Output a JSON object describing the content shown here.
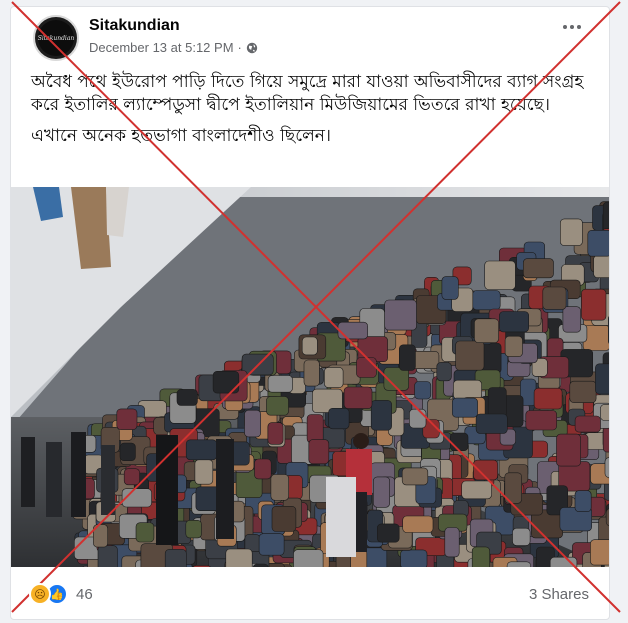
{
  "post": {
    "author": "Sitakundian",
    "timestamp": "December 13 at 5:12 PM",
    "separator": "·",
    "avatar_text": "Sitakundian",
    "privacy_icon": "globe-icon",
    "body_paragraph_1": "অবৈধ পথে ইউরোপ পাড়ি দিতে গিয়ে সমুদ্রে মারা যাওয়া অভিবাসীদের ব্যাগ সংগ্রহ করে ইতালির ল্যাম্পেডুসা দ্বীপে ইতালিয়ান মিউজিয়ামের ভিতরে রাখা হয়েছে।",
    "body_paragraph_2": "এখানে অনেক হতভাগা বাংলাদেশীও ছিলেন।",
    "image_alt": "Wall of piled backpacks inside a museum"
  },
  "footer": {
    "reaction_icons": [
      "sad-reaction-icon",
      "like-reaction-icon"
    ],
    "reaction_count": "46",
    "shares": "3 Shares"
  },
  "colors": {
    "cross_mark": "#d1312f",
    "brand_blue": "#1877f2",
    "muted": "#65676b"
  }
}
